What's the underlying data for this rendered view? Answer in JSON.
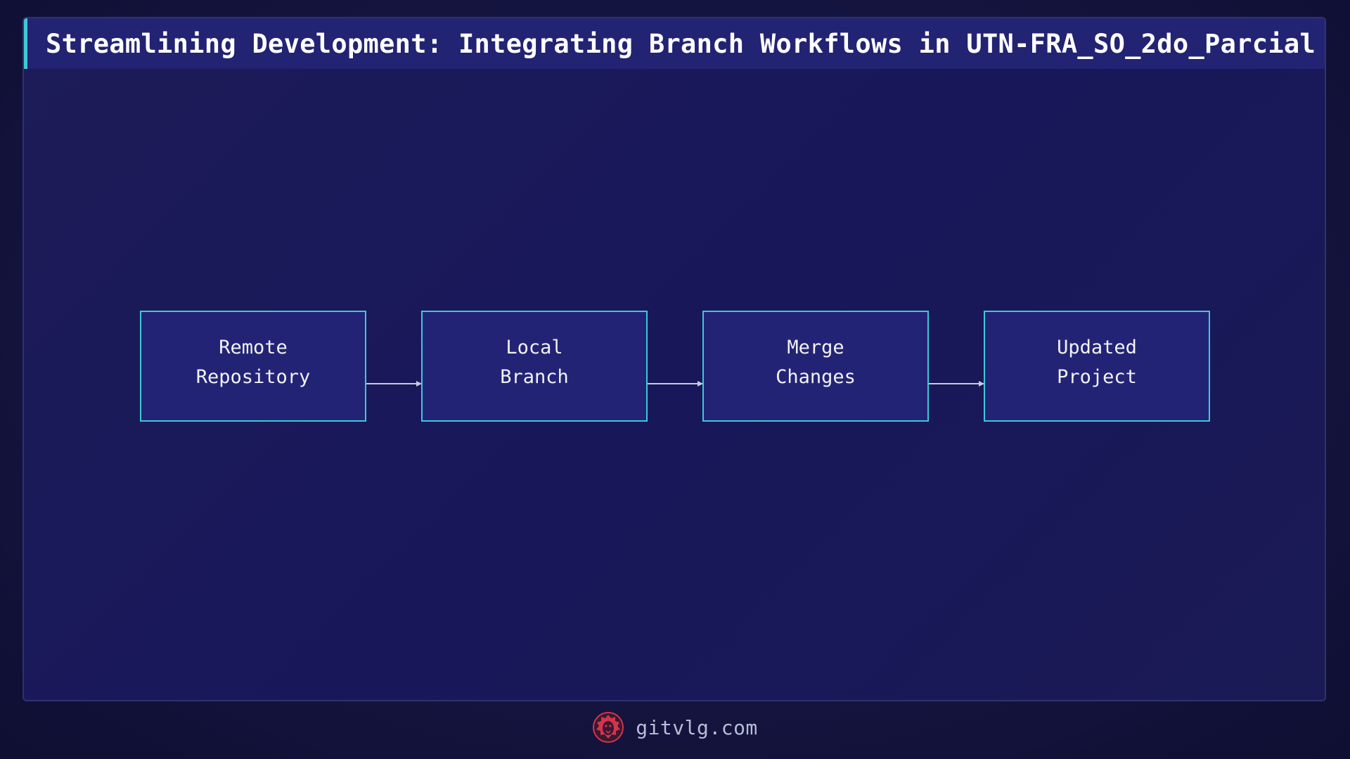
{
  "title": "Streamlining Development: Integrating Branch Workflows in UTN-FRA_SO_2do_Parcial",
  "diagram": {
    "type": "flowchart",
    "direction": "left-to-right",
    "nodes": [
      {
        "id": "remote",
        "label": "Remote\nRepository"
      },
      {
        "id": "local",
        "label": "Local\nBranch"
      },
      {
        "id": "merge",
        "label": "Merge\nChanges"
      },
      {
        "id": "updated",
        "label": "Updated\nProject"
      }
    ],
    "edges": [
      {
        "from": "remote",
        "to": "local"
      },
      {
        "from": "local",
        "to": "merge"
      },
      {
        "from": "merge",
        "to": "updated"
      }
    ]
  },
  "footer": {
    "site": "gitvlg.com",
    "logo_icon": "lion-head-icon"
  },
  "colors": {
    "background": "#14143f",
    "panel": "#1b1a57",
    "title_bar": "#232373",
    "accent": "#3ec8d8",
    "node_fill": "#232376",
    "logo": "#d2354a"
  }
}
